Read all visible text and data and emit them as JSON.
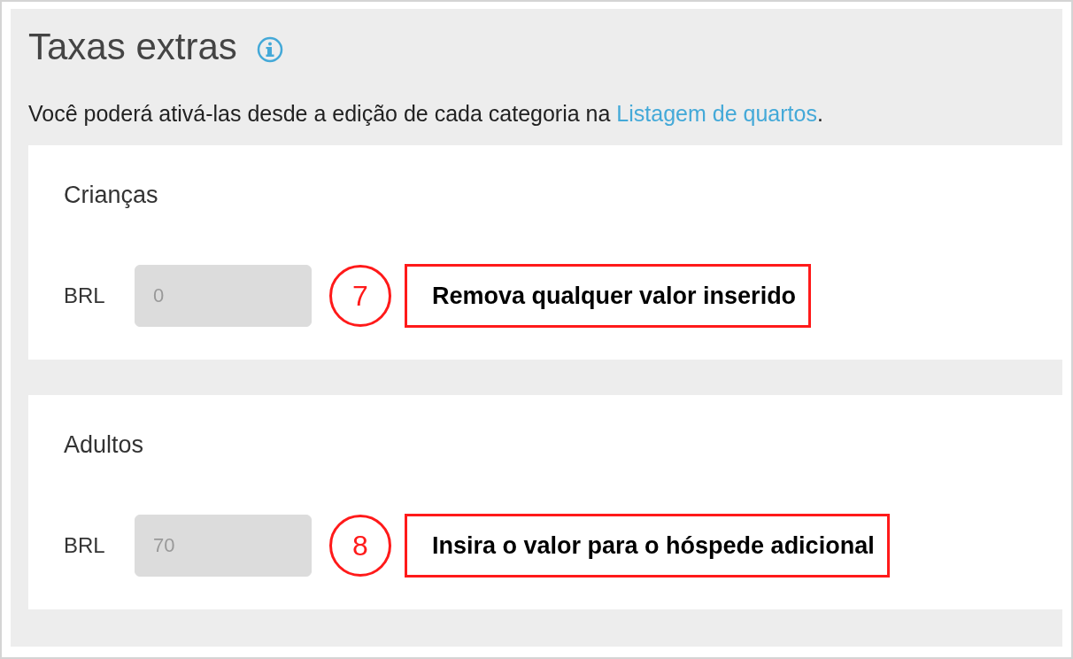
{
  "header": {
    "title": "Taxas extras",
    "info_icon": true
  },
  "description": {
    "text": "Você poderá ativá-las desde a edição de cada categoria na ",
    "link": "Listagem de quartos",
    "end": "."
  },
  "sections": [
    {
      "title": "Crianças",
      "currency": "BRL",
      "value": "0",
      "disabled": true,
      "step": "7",
      "callout": "Remova qualquer valor inserido"
    },
    {
      "title": "Adultos",
      "currency": "BRL",
      "value": "70",
      "disabled": true,
      "step": "8",
      "callout": "Insira o valor para o hóspede adicional"
    }
  ]
}
